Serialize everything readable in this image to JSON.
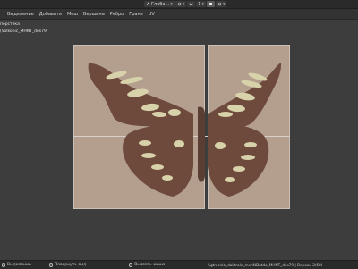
{
  "topbar": {
    "orientation": "Глоба...",
    "snap_value": "1",
    "icons": [
      "orientation-icon",
      "pivot-icon",
      "snap-icon",
      "proportional-edit-icon",
      "overlay-icon"
    ]
  },
  "menubar": {
    "items": [
      "Выделение",
      "Добавить",
      "Меш",
      "Вершина",
      "Ребро",
      "Грань",
      "UV"
    ]
  },
  "viewport": {
    "mode_label": "перстека",
    "object_label": "(Volkonic_MHNT_dos79"
  },
  "statusbar": {
    "left_action": "Выделение",
    "middle_action": "Повернуть вид",
    "right_action": "Вызвать меню",
    "info": "Sgtrocela_daktrale_mehNDatdo_MHNT_dos79 | Версии 2/600 | Рёбер 2/"
  },
  "colors": {
    "plane": "#b49f8f",
    "wing_dark": "#6e4a3d",
    "wing_spot": "#d8d2ab",
    "body": "#5a3e34"
  }
}
